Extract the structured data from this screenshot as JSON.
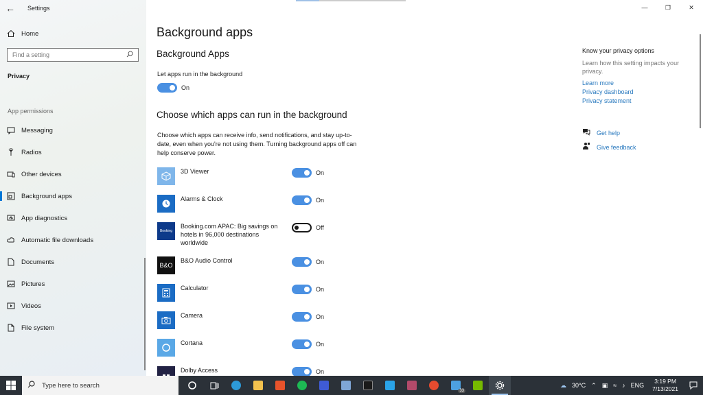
{
  "window": {
    "app_title": "Settings",
    "controls": {
      "minimize": "—",
      "restore": "❐",
      "close": "✕"
    }
  },
  "sidebar": {
    "home_label": "Home",
    "search_placeholder": "Find a setting",
    "privacy_heading": "Privacy",
    "app_permissions_label": "App permissions",
    "items": [
      {
        "label": "Messaging",
        "icon": "message-icon"
      },
      {
        "label": "Radios",
        "icon": "radio-icon"
      },
      {
        "label": "Other devices",
        "icon": "devices-icon"
      },
      {
        "label": "Background apps",
        "icon": "background-apps-icon",
        "active": true
      },
      {
        "label": "App diagnostics",
        "icon": "diagnostics-icon"
      },
      {
        "label": "Automatic file downloads",
        "icon": "cloud-icon"
      },
      {
        "label": "Documents",
        "icon": "document-icon"
      },
      {
        "label": "Pictures",
        "icon": "picture-icon"
      },
      {
        "label": "Videos",
        "icon": "video-icon"
      },
      {
        "label": "File system",
        "icon": "file-icon"
      }
    ]
  },
  "main": {
    "page_title": "Background apps",
    "sub_title": "Background Apps",
    "let_apps_label": "Let apps run in the background",
    "master_toggle": {
      "state": "On",
      "on": true
    },
    "choose_title": "Choose which apps can run in the background",
    "choose_desc": "Choose which apps can receive info, send notifications, and stay up-to-date, even when you're not using them. Turning background apps off can help conserve power.",
    "apps": [
      {
        "name": "3D Viewer",
        "state": "On",
        "on": true,
        "icon": "cube-icon",
        "color": "#7fb6ea"
      },
      {
        "name": "Alarms & Clock",
        "state": "On",
        "on": true,
        "icon": "clock-icon",
        "color": "#1b6cc4"
      },
      {
        "name": "Booking.com APAC: Big savings on hotels in 96,000 destinations worldwide",
        "state": "Off",
        "on": false,
        "icon": "booking-icon",
        "color": "#0d3a8a",
        "icon_text": "Booking"
      },
      {
        "name": "B&O Audio Control",
        "state": "On",
        "on": true,
        "icon": "bo-icon",
        "color": "#111111",
        "icon_text": "B&O"
      },
      {
        "name": "Calculator",
        "state": "On",
        "on": true,
        "icon": "calculator-icon",
        "color": "#1b6cc4"
      },
      {
        "name": "Camera",
        "state": "On",
        "on": true,
        "icon": "camera-icon",
        "color": "#1b6cc4"
      },
      {
        "name": "Cortana",
        "state": "On",
        "on": true,
        "icon": "cortana-icon",
        "color": "#5aa8e6"
      },
      {
        "name": "Dolby Access",
        "state": "On",
        "on": true,
        "icon": "dolby-icon",
        "color": "#222244"
      }
    ]
  },
  "right_panel": {
    "title": "Know your privacy options",
    "desc": "Learn how this setting impacts your privacy.",
    "links": [
      "Learn more",
      "Privacy dashboard",
      "Privacy statement"
    ],
    "get_help": "Get help",
    "give_feedback": "Give feedback"
  },
  "taskbar": {
    "search_placeholder": "Type here to search",
    "badge": "33",
    "temperature": "30°C",
    "language": "ENG",
    "time": "3:19 PM",
    "date": "7/13/2021"
  }
}
